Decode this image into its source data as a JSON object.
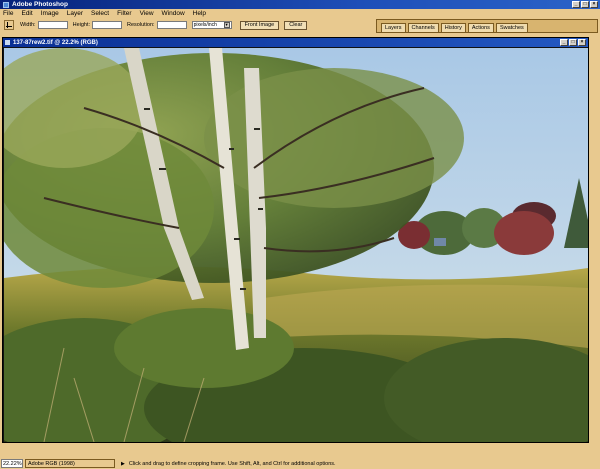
{
  "app": {
    "title": "Adobe Photoshop"
  },
  "menu": [
    "File",
    "Edit",
    "Image",
    "Layer",
    "Select",
    "Filter",
    "View",
    "Window",
    "Help"
  ],
  "options": {
    "width_label": "Width:",
    "height_label": "Height:",
    "resolution_label": "Resolution:",
    "resolution_unit": "pixels/inch",
    "front_image_button": "Front Image",
    "clear_button": "Clear"
  },
  "palette_tabs": [
    "Layers",
    "Channels",
    "History",
    "Actions",
    "Swatches"
  ],
  "document": {
    "title": "137-87rew2.tif @ 22.2% (RGB)"
  },
  "status": {
    "zoom": "22.22%",
    "doc_info": "Adobe RGB (1998)",
    "hint": "Click and drag to define cropping frame. Use Shift, Alt, and Ctrl for additional options."
  },
  "colors": {
    "accent": "#e8c98f",
    "titlebar": "#0a2f94"
  }
}
